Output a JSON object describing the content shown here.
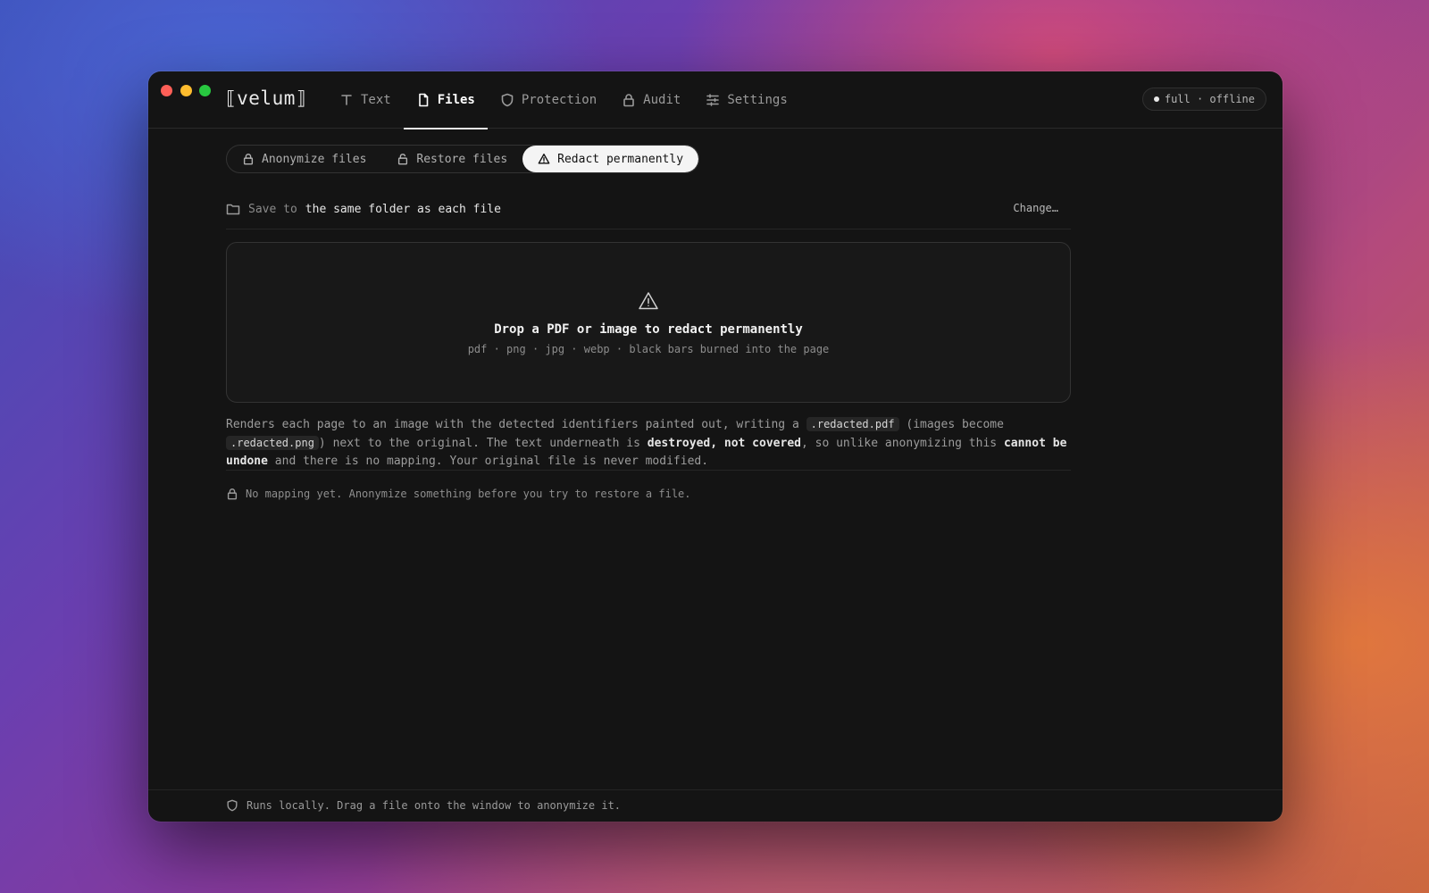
{
  "app": {
    "logo": "⟦velum⟧"
  },
  "nav": {
    "tabs": [
      {
        "label": "Text",
        "icon": "text-icon"
      },
      {
        "label": "Files",
        "icon": "file-icon",
        "active": true
      },
      {
        "label": "Protection",
        "icon": "shield-icon"
      },
      {
        "label": "Audit",
        "icon": "lock-icon"
      },
      {
        "label": "Settings",
        "icon": "sliders-icon"
      }
    ]
  },
  "status": {
    "text": "full · offline"
  },
  "modes": {
    "items": [
      {
        "label": "Anonymize files",
        "icon": "lock-icon"
      },
      {
        "label": "Restore files",
        "icon": "unlock-icon"
      },
      {
        "label": "Redact permanently",
        "icon": "warning-icon",
        "active": true
      }
    ]
  },
  "save": {
    "prefix": "Save to",
    "target": "the same folder as each file",
    "change_label": "Change…"
  },
  "dropzone": {
    "title": "Drop a PDF or image to redact permanently",
    "subtitle": "pdf · png · jpg · webp · black bars burned into the page"
  },
  "description": {
    "part1": "Renders each page to an image with the detected identifiers painted out, writing a ",
    "code1": ".redacted.pdf",
    "part2": " (images become ",
    "code2": ".redacted.png",
    "part3": ") next to the original. The text underneath is ",
    "bold1": "destroyed, not covered",
    "part4": ", so unlike anonymizing this ",
    "bold2": "cannot be undone",
    "part5": " and there is no mapping. Your original file is never modified."
  },
  "mapping": {
    "text": "No mapping yet. Anonymize something before you try to restore a file."
  },
  "footer": {
    "text": "Runs locally. Drag a file onto the window to anonymize it."
  },
  "colors": {
    "window_bg": "#141414",
    "active_tab_bg": "#f4f4f4"
  }
}
